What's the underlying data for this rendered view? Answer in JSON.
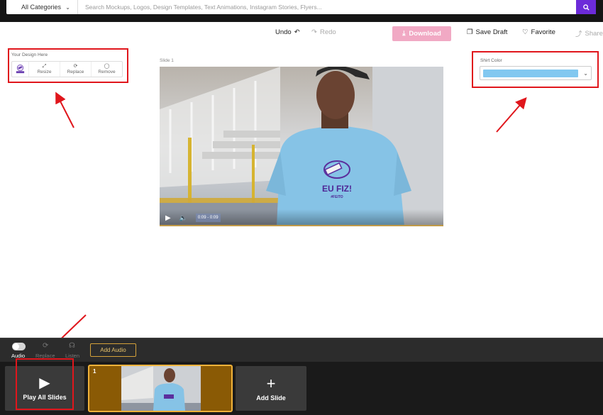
{
  "header": {
    "category_label": "All Categories",
    "search_placeholder": "Search Mockups, Logos, Design Templates, Text Animations, Instagram Stories, Flyers...",
    "search_icon": "search-icon"
  },
  "toolbar": {
    "undo": "Undo",
    "redo": "Redo",
    "download": "Download",
    "save_draft": "Save Draft",
    "favorite": "Favorite",
    "share": "Share"
  },
  "design_panel": {
    "label": "Your Design Here",
    "thumb_text": "Eu Fiz!",
    "resize": "Resize",
    "replace": "Replace",
    "remove": "Remove"
  },
  "slide": {
    "label": "Slide 1",
    "shirt_text": "EU FIZ!",
    "shirt_subtext": "#FEITO",
    "time": "0:09 - 0:09"
  },
  "shirt_color": {
    "label": "Shirt Color",
    "selected_color": "#82c8f0"
  },
  "audio": {
    "audio_label": "Audio",
    "replace_label": "Replace",
    "listen_label": "Listen",
    "add_audio": "Add Audio"
  },
  "slides_bar": {
    "play_all": "Play All Slides",
    "slide_number": "1",
    "add_slide": "Add Slide"
  },
  "colors": {
    "accent_purple": "#6c2bd9",
    "download_pink": "#f1a9c4",
    "highlight_red": "#e0161c",
    "slide_gold": "#f0b23a"
  }
}
